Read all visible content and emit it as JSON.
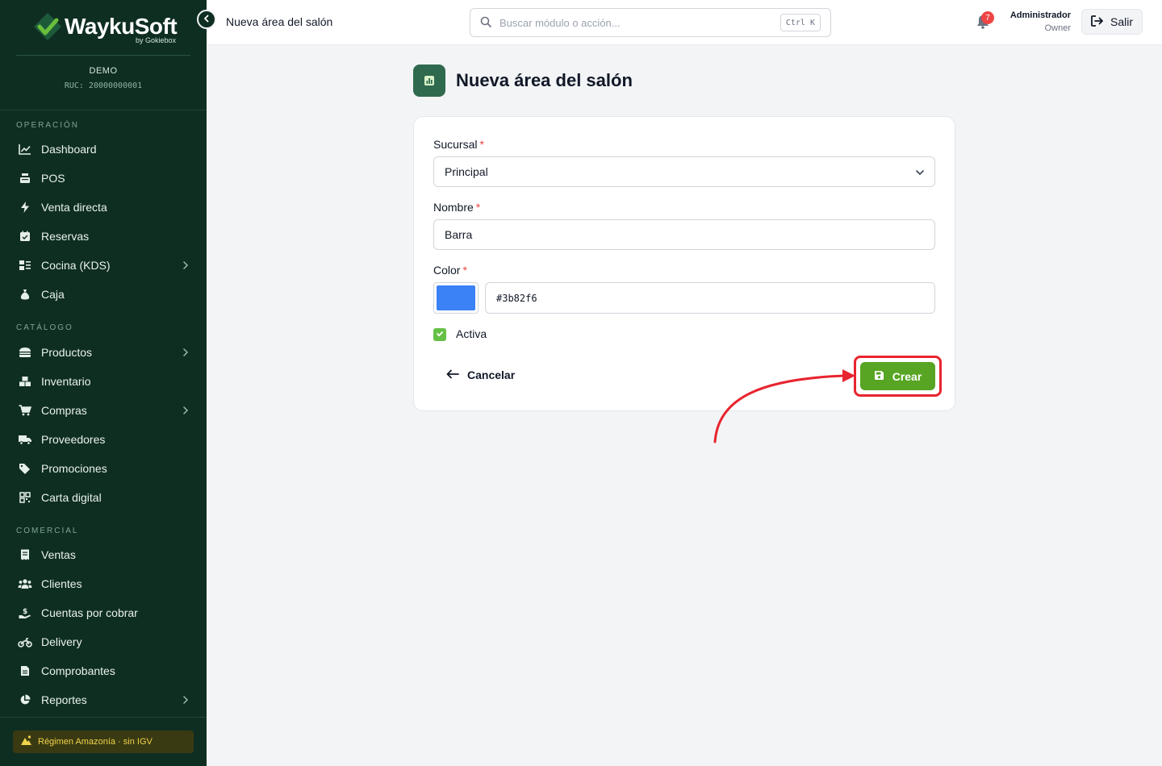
{
  "brand": {
    "name": "WaykuSoft",
    "sub": "by Gokiebox",
    "company": "DEMO",
    "ruc": "RUC: 20000000001",
    "colors": {
      "sidebar_bg": "#0f2e22",
      "accent_green": "#57a523",
      "logo_green": "#6abf3b"
    }
  },
  "sidebar": {
    "sections": [
      {
        "title": "OPERACIÓN",
        "items": [
          {
            "label": "Dashboard",
            "icon": "chart-line-icon"
          },
          {
            "label": "POS",
            "icon": "cash-register-icon"
          },
          {
            "label": "Venta directa",
            "icon": "bolt-icon"
          },
          {
            "label": "Reservas",
            "icon": "calendar-check-icon"
          },
          {
            "label": "Cocina (KDS)",
            "icon": "kitchen-icon",
            "has_submenu": true
          },
          {
            "label": "Caja",
            "icon": "money-bag-icon"
          }
        ]
      },
      {
        "title": "CATÁLOGO",
        "items": [
          {
            "label": "Productos",
            "icon": "burger-icon",
            "has_submenu": true
          },
          {
            "label": "Inventario",
            "icon": "boxes-icon"
          },
          {
            "label": "Compras",
            "icon": "cart-icon",
            "has_submenu": true
          },
          {
            "label": "Proveedores",
            "icon": "truck-icon"
          },
          {
            "label": "Promociones",
            "icon": "tags-icon"
          },
          {
            "label": "Carta digital",
            "icon": "qr-code-icon"
          }
        ]
      },
      {
        "title": "COMERCIAL",
        "items": [
          {
            "label": "Ventas",
            "icon": "receipt-icon"
          },
          {
            "label": "Clientes",
            "icon": "users-icon"
          },
          {
            "label": "Cuentas por cobrar",
            "icon": "hand-dollar-icon"
          },
          {
            "label": "Delivery",
            "icon": "motorcycle-icon"
          },
          {
            "label": "Comprobantes",
            "icon": "file-invoice-icon"
          },
          {
            "label": "Reportes",
            "icon": "pie-chart-icon",
            "has_submenu": true
          }
        ]
      }
    ],
    "regimen": "Régimen Amazonía · sin IGV"
  },
  "topbar": {
    "breadcrumb": "Nueva área del salón",
    "search_placeholder": "Buscar módulo o acción...",
    "shortcut": "Ctrl K",
    "notifications": "7",
    "user_name": "Administrador",
    "user_role": "Owner",
    "logout_label": "Salir"
  },
  "page": {
    "title": "Nueva área del salón",
    "form": {
      "sucursal_label": "Sucursal",
      "sucursal_value": "Principal",
      "nombre_label": "Nombre",
      "nombre_value": "Barra",
      "color_label": "Color",
      "color_value": "#3b82f6",
      "activa_label": "Activa",
      "activa_checked": true,
      "required_mark": "*",
      "cancel_label": "Cancelar",
      "submit_label": "Crear"
    }
  }
}
